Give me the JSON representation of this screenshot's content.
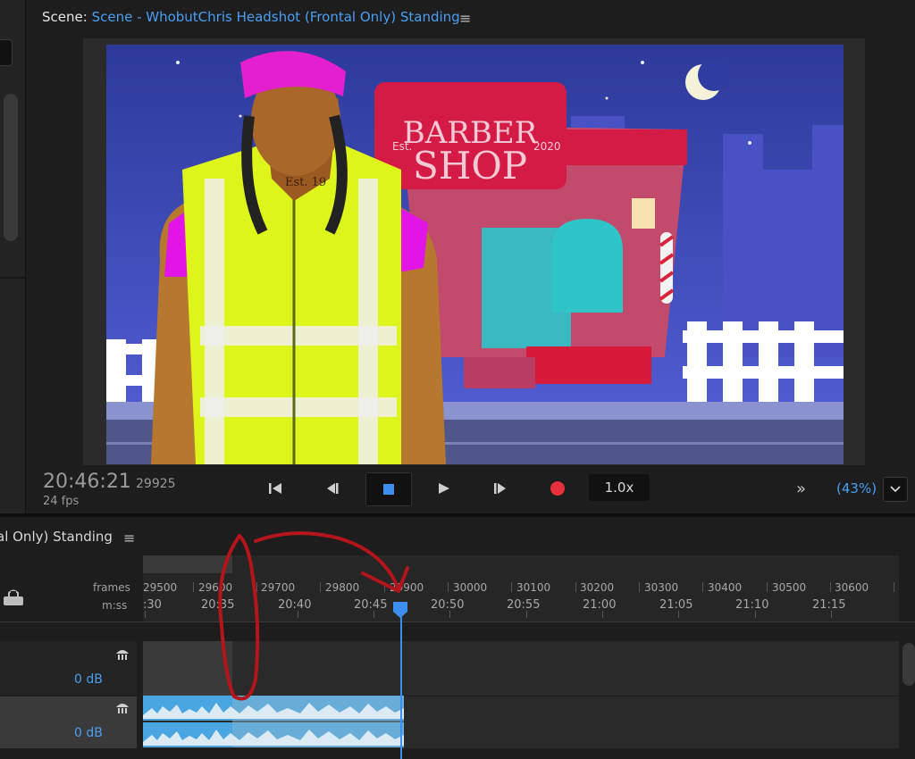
{
  "scene": {
    "prefix": "Scene:",
    "name": "Scene - WhobutChris Headshot (Frontal Only) Standing"
  },
  "canvas_art": {
    "sign_line1": "BARBER",
    "sign_line2": "SHOP",
    "sign_left": "Est.",
    "sign_right": "2020",
    "tattoo": "Est. 19"
  },
  "transport": {
    "timecode": "20:46:21",
    "frame": "29925",
    "fps": "24 fps",
    "speed": "1.0x",
    "zoom": "(43%)",
    "more": "»"
  },
  "timeline": {
    "title": "al Only) Standing",
    "frames_label": "frames",
    "mss_label": "m:ss",
    "frames": [
      "29500",
      "29600",
      "29700",
      "29800",
      "29900",
      "30000",
      "30100",
      "30200",
      "30300",
      "30400",
      "30500",
      "30600"
    ],
    "times": [
      ":30",
      "20:35",
      "20:40",
      "20:45",
      "20:50",
      "20:55",
      "21:00",
      "21:05",
      "21:10",
      "21:15"
    ],
    "tracks": [
      {
        "db": "0 dB"
      },
      {
        "db": "0 dB"
      }
    ]
  },
  "colors": {
    "accent": "#3c8ff0",
    "link": "#4a9ff5",
    "record": "#e8313a",
    "annotation": "#b3151b"
  }
}
